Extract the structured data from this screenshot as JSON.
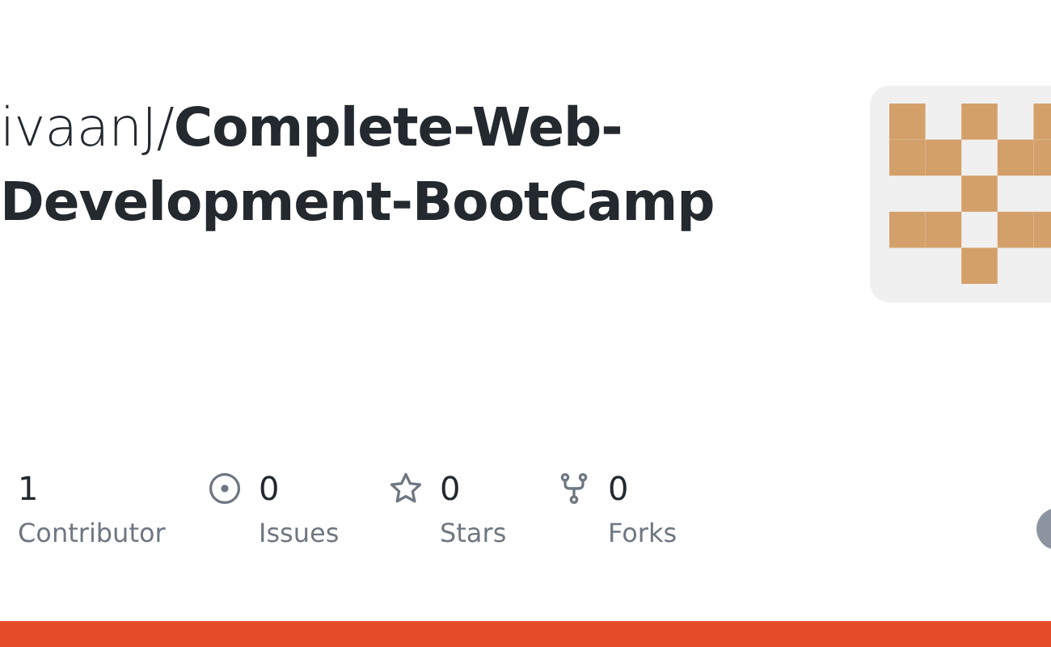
{
  "title": "ivaanJ/**Complete-Web-Development-BootCamp**",
  "stats": [
    {
      "kind": "contributors",
      "value": "1",
      "label": "Contributor"
    },
    {
      "kind": "issues",
      "value": "0",
      "label": "Issues"
    },
    {
      "kind": "stars",
      "value": "0",
      "label": "Stars"
    },
    {
      "kind": "forks",
      "value": "0",
      "label": "Forks"
    }
  ]
}
